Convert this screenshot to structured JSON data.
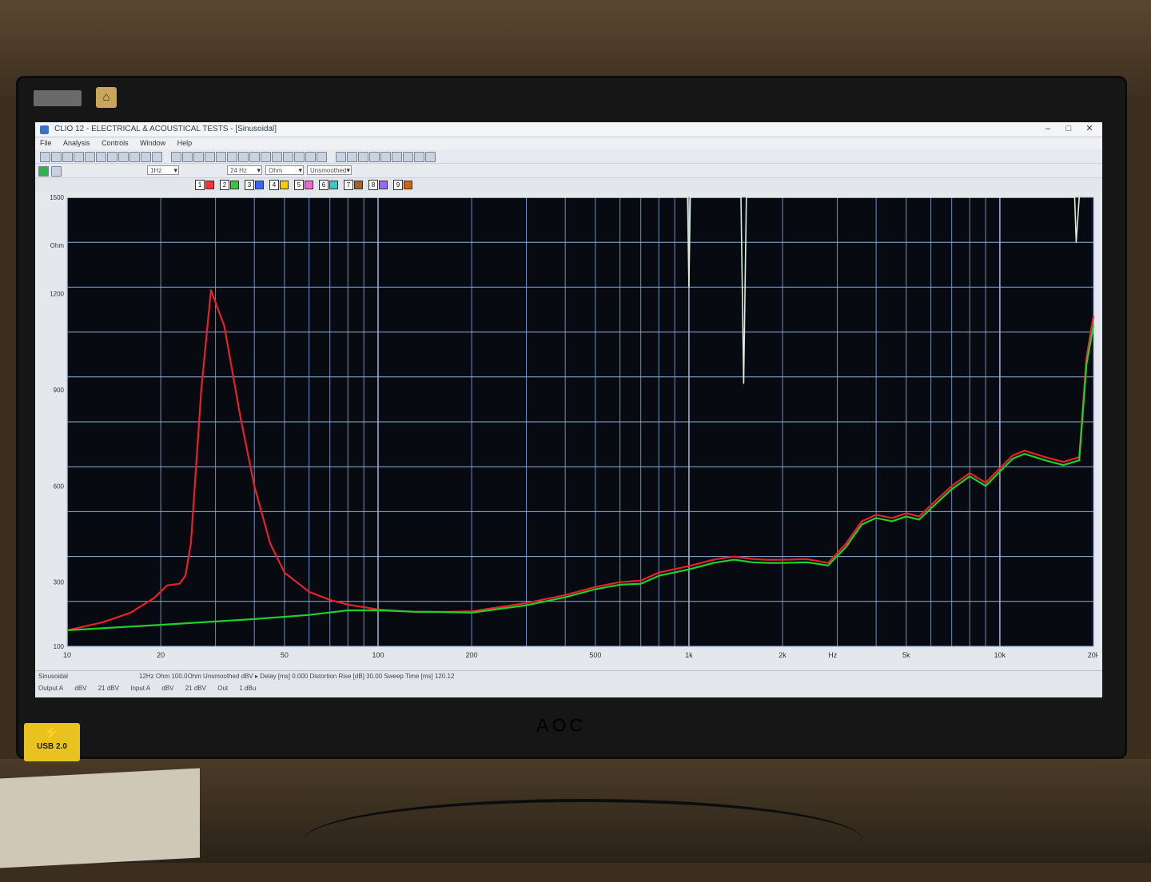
{
  "window": {
    "title": "CLIO 12 - ELECTRICAL & ACOUSTICAL TESTS - [Sinusoidal]",
    "controls": [
      "–",
      "□",
      "✕"
    ]
  },
  "menu": [
    "File",
    "Analysis",
    "Controls",
    "Window",
    "Help"
  ],
  "toolbar": {
    "input_range": "1Hz",
    "unit": "Ohm",
    "freq": "24 Hz",
    "smoothing": "Unsmoothed"
  },
  "trace_numbers": [
    "1",
    "2",
    "3",
    "4",
    "5",
    "6",
    "7",
    "8",
    "9"
  ],
  "trace_colors": [
    "#ff3333",
    "#33cc33",
    "#3366ff",
    "#ffcc00",
    "#ff66cc",
    "#33cccc",
    "#996633",
    "#9966ff",
    "#cc6600"
  ],
  "chart_data": {
    "type": "line",
    "xlabel": "Hz",
    "ylabel": "Ohm",
    "x_scale": "log",
    "xlim": [
      10,
      20000
    ],
    "ylim": [
      100,
      1500
    ],
    "x_tick_labels": [
      "10",
      "20",
      "50",
      "100",
      "200",
      "500",
      "1k",
      "2k",
      "5k",
      "10k",
      "20k"
    ],
    "x_tick_values": [
      10,
      20,
      50,
      100,
      200,
      500,
      1000,
      2000,
      5000,
      10000,
      20000
    ],
    "y_tick_labels": [
      "100",
      "300",
      "600",
      "900",
      "1200",
      "1500"
    ],
    "y_tick_values": [
      100,
      300,
      600,
      900,
      1200,
      1500
    ],
    "grid": true,
    "series": [
      {
        "color": "#e8202a",
        "x": [
          10,
          13,
          16,
          19,
          21,
          23,
          24,
          25,
          27,
          29,
          32,
          36,
          40,
          45,
          50,
          60,
          70,
          80,
          100,
          130,
          160,
          200,
          300,
          400,
          500,
          600,
          700,
          800,
          1000,
          1200,
          1400,
          1600,
          1800,
          2000,
          2400,
          2800,
          3200,
          3600,
          4000,
          4500,
          5000,
          5500,
          6000,
          7000,
          8000,
          9000,
          10000,
          11000,
          12000,
          14000,
          16000,
          18000,
          19000,
          20000
        ],
        "y": [
          150,
          175,
          205,
          250,
          290,
          295,
          320,
          420,
          900,
          1210,
          1100,
          820,
          600,
          420,
          330,
          270,
          245,
          230,
          215,
          207,
          207,
          209,
          235,
          260,
          285,
          300,
          305,
          330,
          350,
          370,
          380,
          372,
          370,
          370,
          372,
          360,
          420,
          490,
          510,
          500,
          515,
          505,
          540,
          600,
          640,
          610,
          655,
          695,
          710,
          690,
          675,
          690,
          1000,
          1130
        ]
      },
      {
        "color": "#1fcf2c",
        "x": [
          10,
          20,
          40,
          60,
          80,
          100,
          130,
          160,
          200,
          300,
          400,
          500,
          600,
          700,
          800,
          1000,
          1200,
          1400,
          1600,
          1800,
          2000,
          2400,
          2800,
          3200,
          3600,
          4000,
          4500,
          5000,
          5500,
          6000,
          7000,
          8000,
          9000,
          10000,
          11000,
          12000,
          14000,
          16000,
          18000,
          19000,
          20000
        ],
        "y": [
          150,
          167,
          185,
          198,
          212,
          212,
          208,
          207,
          205,
          228,
          253,
          278,
          292,
          295,
          320,
          340,
          360,
          370,
          362,
          360,
          360,
          362,
          352,
          410,
          480,
          500,
          490,
          505,
          495,
          530,
          590,
          630,
          600,
          645,
          685,
          700,
          680,
          665,
          680,
          980,
          1100
        ]
      },
      {
        "color": "#d8eddc",
        "x": [
          10,
          500,
          800,
          900,
          990,
          1000,
          1010,
          1100,
          1300,
          1400,
          1470,
          1500,
          1530,
          1600,
          1800,
          2000,
          5000,
          10000,
          15000,
          16800,
          17400,
          17600,
          18000,
          19000,
          20000
        ],
        "y": [
          1500,
          1500,
          1500,
          1500,
          1500,
          1220,
          1500,
          1500,
          1500,
          1500,
          1500,
          920,
          1500,
          1500,
          1500,
          1500,
          1500,
          1500,
          1500,
          1500,
          1500,
          1360,
          1500,
          1550,
          1550
        ]
      }
    ]
  },
  "status": {
    "name": "Sinusoidal",
    "line": "12Hz   Ohm   100.0Ohm   Unsmoothed   dBV ▸   Delay [ms] 0.000   Distortion Rise [dB] 30.00   Sweep Time [ms] 120.12",
    "controls": [
      "Output A",
      "dBV",
      "21 dBV",
      "Input A",
      "dBV",
      "21 dBV",
      "Out",
      "1 dBu"
    ]
  },
  "monitor": {
    "brand": "AOC",
    "usb_label": "USB 2.0"
  }
}
